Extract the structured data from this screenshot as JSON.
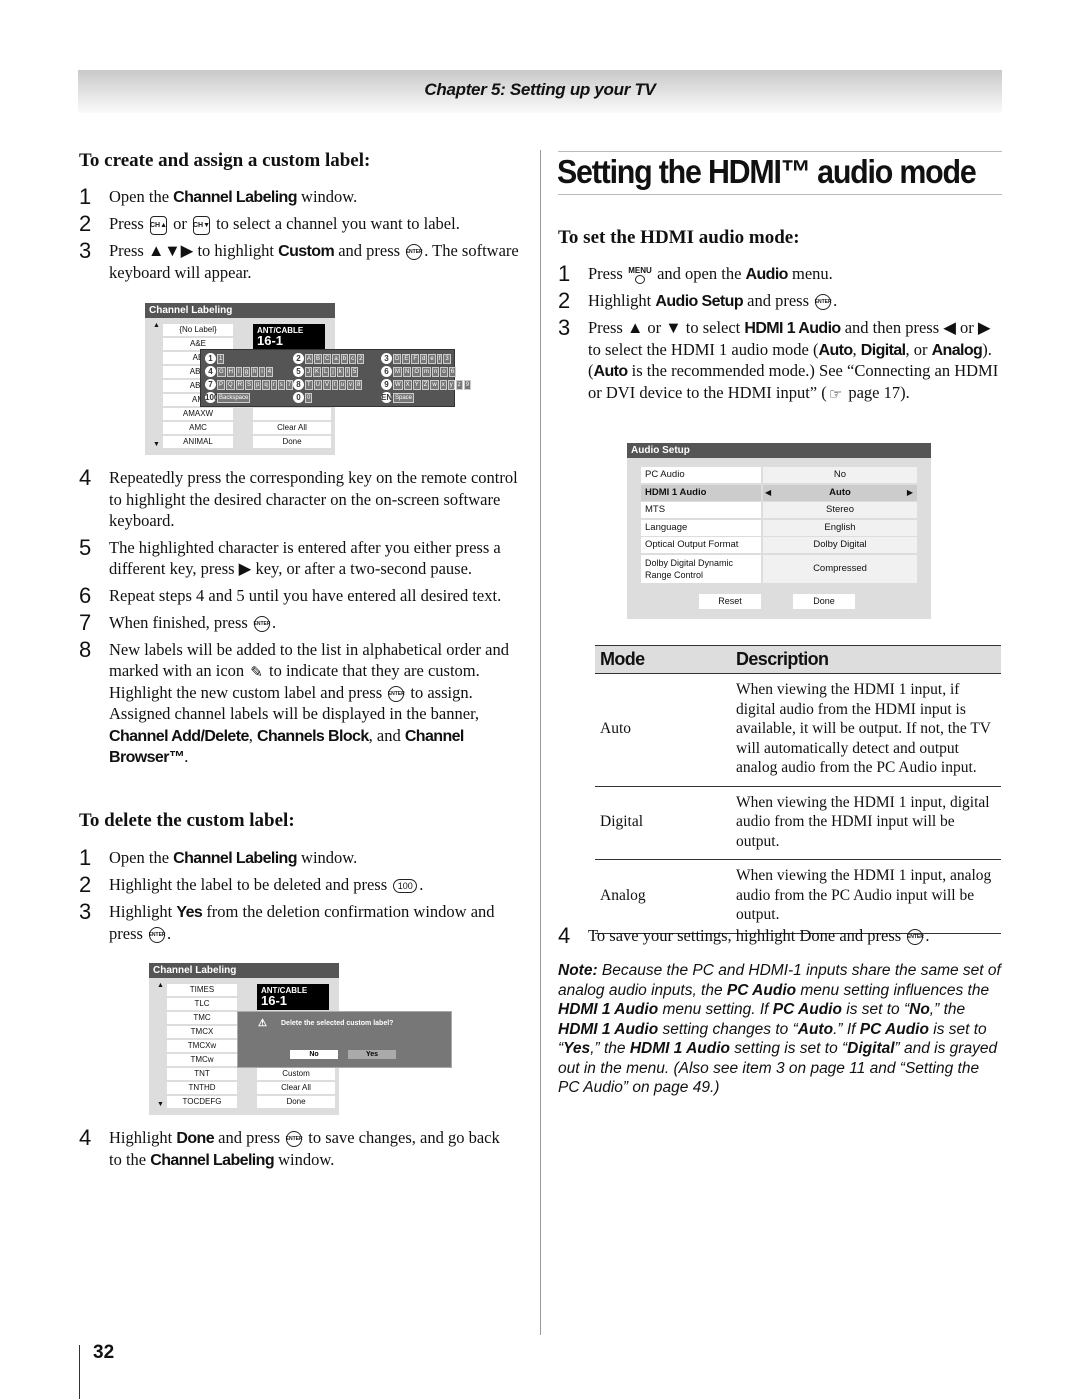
{
  "header": {
    "chapter": "Chapter 5: Setting up your TV"
  },
  "icons": {
    "enter": "ENTER",
    "ch_up": "CH▲",
    "ch_down": "CH▼",
    "menu": "MENU",
    "hundred": "100",
    "pencil": "✎",
    "pageref": "☞"
  },
  "left": {
    "create_heading": "To create and assign a custom label:",
    "create_steps": [
      {
        "num": "1",
        "segs": [
          {
            "t": "Open the "
          },
          {
            "b": "Channel Labeling"
          },
          {
            "t": " window."
          }
        ]
      },
      {
        "num": "2",
        "segs": [
          {
            "t": "Press "
          },
          {
            "i": "ch_up"
          },
          {
            "t": " or "
          },
          {
            "i": "ch_down"
          },
          {
            "t": " to select a channel you want to label."
          }
        ]
      },
      {
        "num": "3",
        "segs": [
          {
            "t": "Press ▲▼▶ to highlight "
          },
          {
            "b": "Custom"
          },
          {
            "t": " and press "
          },
          {
            "i": "enter"
          },
          {
            "t": ". The software keyboard will appear."
          }
        ]
      }
    ],
    "create_steps2": [
      {
        "num": "4",
        "segs": [
          {
            "t": "Repeatedly press the corresponding key on the remote control to highlight the desired character on the on-screen software keyboard."
          }
        ]
      },
      {
        "num": "5",
        "segs": [
          {
            "t": "The highlighted character is entered after you either press a different key, press ▶ key, or after a two-second pause."
          }
        ]
      },
      {
        "num": "6",
        "segs": [
          {
            "t": "Repeat steps 4 and 5 until you have entered all desired text."
          }
        ]
      },
      {
        "num": "7",
        "segs": [
          {
            "t": "When finished, press "
          },
          {
            "i": "enter"
          },
          {
            "t": "."
          }
        ]
      },
      {
        "num": "8",
        "segs": [
          {
            "t": "New labels will be added to the list in alphabetical order and marked with an icon "
          },
          {
            "i": "pencil"
          },
          {
            "t": " to indicate that they are custom. Highlight the new custom label and press "
          },
          {
            "i": "enter"
          },
          {
            "t": " to assign. Assigned channel labels will be displayed in the banner, "
          },
          {
            "b": "Channel Add/Delete"
          },
          {
            "t": ", "
          },
          {
            "b": "Channels Block"
          },
          {
            "t": ", and "
          },
          {
            "b": "Channel Browser™"
          },
          {
            "t": "."
          }
        ]
      }
    ],
    "delete_heading": "To delete the custom label:",
    "delete_steps": [
      {
        "num": "1",
        "segs": [
          {
            "t": "Open the "
          },
          {
            "b": "Channel Labeling"
          },
          {
            "t": " window."
          }
        ]
      },
      {
        "num": "2",
        "segs": [
          {
            "t": "Highlight the label to be deleted and press "
          },
          {
            "i": "hundred"
          },
          {
            "t": "."
          }
        ]
      },
      {
        "num": "3",
        "segs": [
          {
            "t": "Highlight "
          },
          {
            "b": "Yes"
          },
          {
            "t": " from the deletion confirmation window and press "
          },
          {
            "i": "enter"
          },
          {
            "t": "."
          }
        ]
      }
    ],
    "delete_steps2": [
      {
        "num": "4",
        "segs": [
          {
            "t": "Highlight "
          },
          {
            "b": "Done"
          },
          {
            "t": " and press "
          },
          {
            "i": "enter"
          },
          {
            "t": " to save changes, and go back to the "
          },
          {
            "b": "Channel Labeling"
          },
          {
            "t": " window."
          }
        ]
      }
    ]
  },
  "osd1": {
    "title": "Channel Labeling",
    "list": [
      "{No Label}",
      "A&E",
      "AE",
      "ABC",
      "ABC",
      "AM",
      "AMAXW",
      "AMC",
      "ANIMAL"
    ],
    "input": "ANT/CABLE",
    "channel": "16-1",
    "right": [
      "",
      "Clear All",
      "Done"
    ],
    "keys": [
      {
        "n": "1",
        "c": [
          "1"
        ]
      },
      {
        "n": "2",
        "c": [
          "A",
          "B",
          "C",
          "a",
          "b",
          "c",
          "2"
        ]
      },
      {
        "n": "3",
        "c": [
          "D",
          "E",
          "F",
          "d",
          "e",
          "f",
          "3"
        ]
      },
      {
        "n": "4",
        "c": [
          "G",
          "H",
          "I",
          "g",
          "h",
          "i",
          "4"
        ]
      },
      {
        "n": "5",
        "c": [
          "J",
          "K",
          "L",
          "j",
          "k",
          "l",
          "5"
        ]
      },
      {
        "n": "6",
        "c": [
          "M",
          "N",
          "O",
          "m",
          "n",
          "o",
          "6"
        ]
      },
      {
        "n": "7",
        "c": [
          "P",
          "Q",
          "R",
          "S",
          "p",
          "q",
          "r",
          "s",
          "7"
        ]
      },
      {
        "n": "8",
        "c": [
          "T",
          "U",
          "V",
          "t",
          "u",
          "v",
          "8"
        ]
      },
      {
        "n": "9",
        "c": [
          "W",
          "X",
          "Y",
          "Z",
          "w",
          "x",
          "y",
          "z",
          "9"
        ]
      },
      {
        "n": "100",
        "c": [
          "Backspace"
        ]
      },
      {
        "n": "0",
        "c": [
          "0"
        ]
      },
      {
        "n": "ENT",
        "c": [
          "Space"
        ]
      }
    ]
  },
  "osd2": {
    "title": "Channel Labeling",
    "list": [
      "TIMES",
      "TLC",
      "TMC",
      "TMCX",
      "TMCXw",
      "TMCw",
      "TNT",
      "TNTHD",
      "TOCDEFG"
    ],
    "input": "ANT/CABLE",
    "channel": "16-1",
    "right": [
      "Custom",
      "Clear All",
      "Done"
    ],
    "dialog": {
      "message": "Delete the selected custom label?",
      "no": "No",
      "yes": "Yes"
    }
  },
  "right": {
    "title": "Setting the HDMI™ audio mode",
    "heading": "To set the HDMI audio mode:",
    "steps": [
      {
        "num": "1",
        "segs": [
          {
            "t": "Press "
          },
          {
            "i": "menu"
          },
          {
            "t": " and open the "
          },
          {
            "b": "Audio"
          },
          {
            "t": " menu."
          }
        ]
      },
      {
        "num": "2",
        "segs": [
          {
            "t": "Highlight "
          },
          {
            "b": "Audio Setup"
          },
          {
            "t": " and press "
          },
          {
            "i": "enter"
          },
          {
            "t": "."
          }
        ]
      },
      {
        "num": "3",
        "segs": [
          {
            "t": "Press ▲ or ▼ to select "
          },
          {
            "b": "HDMI 1 Audio"
          },
          {
            "t": " and then press ◀ or ▶ to select the HDMI 1 audio mode ("
          },
          {
            "b": "Auto"
          },
          {
            "t": ", "
          },
          {
            "b": "Digital"
          },
          {
            "t": ", or "
          },
          {
            "b": "Analog"
          },
          {
            "t": "). ("
          },
          {
            "b": "Auto"
          },
          {
            "t": " is the recommended mode.) See “Connecting an HDMI or DVI device to the HDMI input” ("
          },
          {
            "i": "pageref"
          },
          {
            "t": " page 17)."
          }
        ]
      }
    ],
    "steps2": [
      {
        "num": "4",
        "segs": [
          {
            "t": "To save your settings, highlight Done and press "
          },
          {
            "i": "enter"
          },
          {
            "t": "."
          }
        ]
      }
    ],
    "audio_setup": {
      "title": "Audio Setup",
      "rows": [
        {
          "label": "PC Audio",
          "value": "No"
        },
        {
          "label": "HDMI 1 Audio",
          "value": "Auto",
          "selected": true
        },
        {
          "label": "MTS",
          "value": "Stereo"
        },
        {
          "label": "Language",
          "value": "English"
        },
        {
          "label": "Optical Output Format",
          "value": "Dolby Digital"
        },
        {
          "label": "Dolby Digital Dynamic Range Control",
          "value": "Compressed"
        }
      ],
      "reset": "Reset",
      "done": "Done"
    },
    "table": {
      "headers": [
        "Mode",
        "Description"
      ],
      "rows": [
        {
          "mode": "Auto",
          "desc": "When viewing the HDMI 1 input, if digital audio from the HDMI input is available, it will be output. If not, the TV will automatically detect and output analog audio from the PC Audio input."
        },
        {
          "mode": "Digital",
          "desc": "When viewing the HDMI 1 input, digital audio from the HDMI input will be output."
        },
        {
          "mode": "Analog",
          "desc": "When viewing the HDMI 1 input, analog audio from the PC Audio input will be output."
        }
      ]
    },
    "note": [
      {
        "nb": "Note:"
      },
      {
        "t": " Because the PC and HDMI-1 inputs share the same set of analog audio inputs, the "
      },
      {
        "nb": "PC Audio"
      },
      {
        "t": " menu setting influences the "
      },
      {
        "nb": "HDMI 1 Audio"
      },
      {
        "t": " menu setting. If "
      },
      {
        "nb": "PC Audio"
      },
      {
        "t": " is set to “"
      },
      {
        "nb": "No"
      },
      {
        "t": ",” the "
      },
      {
        "nb": "HDMI 1 Audio"
      },
      {
        "t": " setting changes to “"
      },
      {
        "nb": "Auto"
      },
      {
        "t": ".” If "
      },
      {
        "nb": "PC Audio"
      },
      {
        "t": " is set to “"
      },
      {
        "nb": "Yes"
      },
      {
        "t": ",” the "
      },
      {
        "nb": "HDMI 1 Audio"
      },
      {
        "t": " setting is set to “"
      },
      {
        "nb": "Digital"
      },
      {
        "t": "” and is grayed out in the menu. (Also see item 3 on page 11 and “Setting the PC Audio” on page 49.)"
      }
    ]
  },
  "footer": {
    "page_number": "32"
  }
}
